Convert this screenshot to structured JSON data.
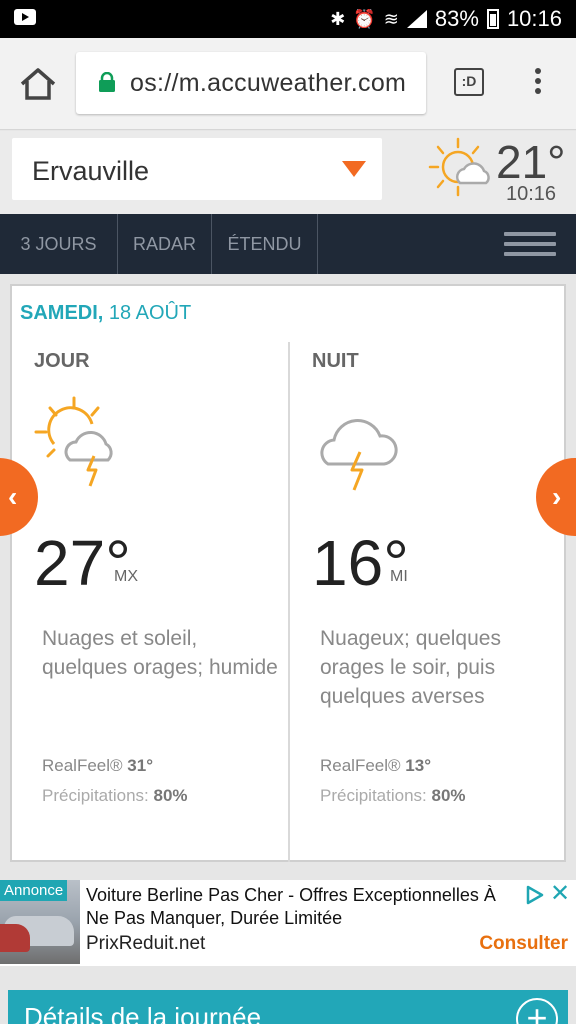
{
  "status_bar": {
    "battery": "83%",
    "time": "10:16"
  },
  "browser": {
    "url": "os://m.accuweather.com",
    "tabs_label": ":D"
  },
  "location": {
    "name": "Ervauville"
  },
  "current": {
    "temp": "21°",
    "time": "10:16",
    "icon": "sun-cloud-icon"
  },
  "nav": {
    "items": [
      "3 JOURS",
      "RADAR",
      "ÉTENDU"
    ]
  },
  "forecast": {
    "date_day": "SAMEDI,",
    "date_rest": " 18 AOÛT",
    "day": {
      "label": "JOUR",
      "icon": "sun-cloud-thunder-icon",
      "temp": "27°",
      "unit": "MX",
      "description": "Nuages et soleil, quelques orages; humide",
      "realfeel_label": "RealFeel® ",
      "realfeel_value": "31°",
      "precip_label": "Précipitations: ",
      "precip_value": "80%"
    },
    "night": {
      "label": "NUIT",
      "icon": "cloud-thunder-icon",
      "temp": "16°",
      "unit": "MI",
      "description": "Nuageux; quelques orages le soir, puis quelques averses",
      "realfeel_label": "RealFeel® ",
      "realfeel_value": "13°",
      "precip_label": "Précipitations: ",
      "precip_value": "80%"
    }
  },
  "ad": {
    "badge": "Annonce",
    "title": "Voiture Berline Pas Cher - Offres Exceptionnelles À Ne Pas Manquer, Durée Limitée",
    "domain": "PrixReduit.net",
    "cta": "Consulter"
  },
  "details": {
    "label": "Détails de la journée"
  },
  "colors": {
    "accent": "#22a7b8",
    "orange": "#f26a22",
    "nav_bg": "#1f2937"
  }
}
